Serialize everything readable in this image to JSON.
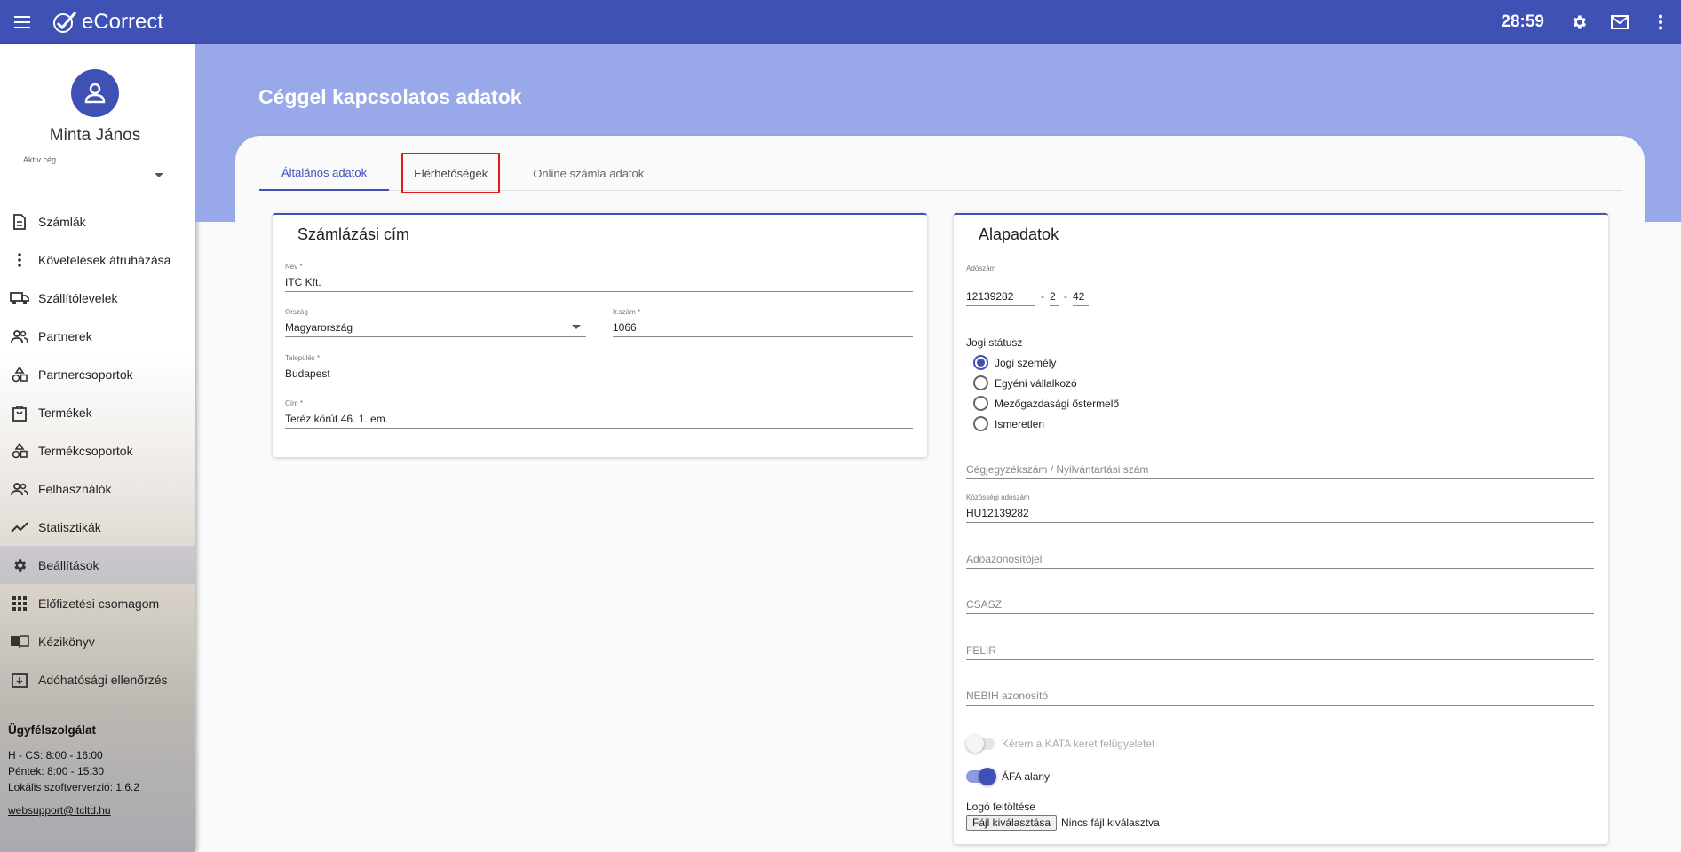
{
  "app": {
    "title": "eCorrect",
    "timer": "28:59"
  },
  "user": {
    "name": "Minta János",
    "company_label": "Aktív cég",
    "company_value": ""
  },
  "nav": [
    {
      "label": "Számlák",
      "icon": "document-icon"
    },
    {
      "label": "Követelések átruházása",
      "icon": "more-vert-icon"
    },
    {
      "label": "Szállítólevelek",
      "icon": "truck-icon"
    },
    {
      "label": "Partnerek",
      "icon": "people-icon"
    },
    {
      "label": "Partnercsoportok",
      "icon": "shapes-icon"
    },
    {
      "label": "Termékek",
      "icon": "shopping-bag-icon"
    },
    {
      "label": "Termékcsoportok",
      "icon": "shapes-icon"
    },
    {
      "label": "Felhasználók",
      "icon": "people-icon"
    },
    {
      "label": "Statisztikák",
      "icon": "trending-icon"
    },
    {
      "label": "Beállítások",
      "icon": "gear-icon"
    },
    {
      "label": "Előfizetési csomagom",
      "icon": "apps-grid-icon"
    },
    {
      "label": "Kézikönyv",
      "icon": "book-icon"
    },
    {
      "label": "Adóhatósági ellenőrzés",
      "icon": "archive-icon"
    }
  ],
  "support": {
    "title": "Ügyfélszolgálat",
    "line1": "H - CS: 8:00 - 16:00",
    "line2": "Péntek: 8:00 - 15:30",
    "line3": "Lokális szoftververzió: 1.6.2",
    "email": "websupport@itcltd.hu"
  },
  "page": {
    "title": "Céggel kapcsolatos adatok"
  },
  "tabs": [
    "Általános adatok",
    "Elérhetőségek",
    "Online számla adatok"
  ],
  "billing": {
    "title": "Számlázási cím",
    "name_label": "Név *",
    "name_value": "ITC Kft.",
    "country_label": "Ország",
    "country_value": "Magyarország",
    "zip_label": "Ir.szám *",
    "zip_value": "1066",
    "city_label": "Település *",
    "city_value": "Budapest",
    "address_label": "Cím *",
    "address_value": "Teréz körút 46. 1. em."
  },
  "basic": {
    "title": "Alapadatok",
    "tax_label": "Adószám",
    "tax_part1": "12139282",
    "tax_part2": "2",
    "tax_part3": "42",
    "tax_dash": "-",
    "legal_status_title": "Jogi státusz",
    "legal_options": [
      "Jogi személy",
      "Egyéni vállalkozó",
      "Mezőgazdasági őstermelő",
      "Ismeretlen"
    ],
    "legal_selected": "Jogi személy",
    "reg_placeholder": "Cégjegyzékszám / Nyilvántartási szám",
    "eu_tax_label": "Közösségi adószám",
    "eu_tax_value": "HU12139282",
    "taxid_placeholder": "Adóazonosítójel",
    "csasz_placeholder": "CSASZ",
    "felir_placeholder": "FELIR",
    "nebih_placeholder": "NEBIH azonosító",
    "kata_label": "Kérem a KATA keret felügyeletet",
    "afa_label": "ÁFA alany",
    "logo_label": "Logó feltöltése",
    "file_button": "Fájl kiválasztása",
    "file_status": "Nincs fájl kiválasztva"
  },
  "colors": {
    "primary": "#3f51b5",
    "hero": "#98a8e8",
    "highlight": "#e11b1b"
  }
}
